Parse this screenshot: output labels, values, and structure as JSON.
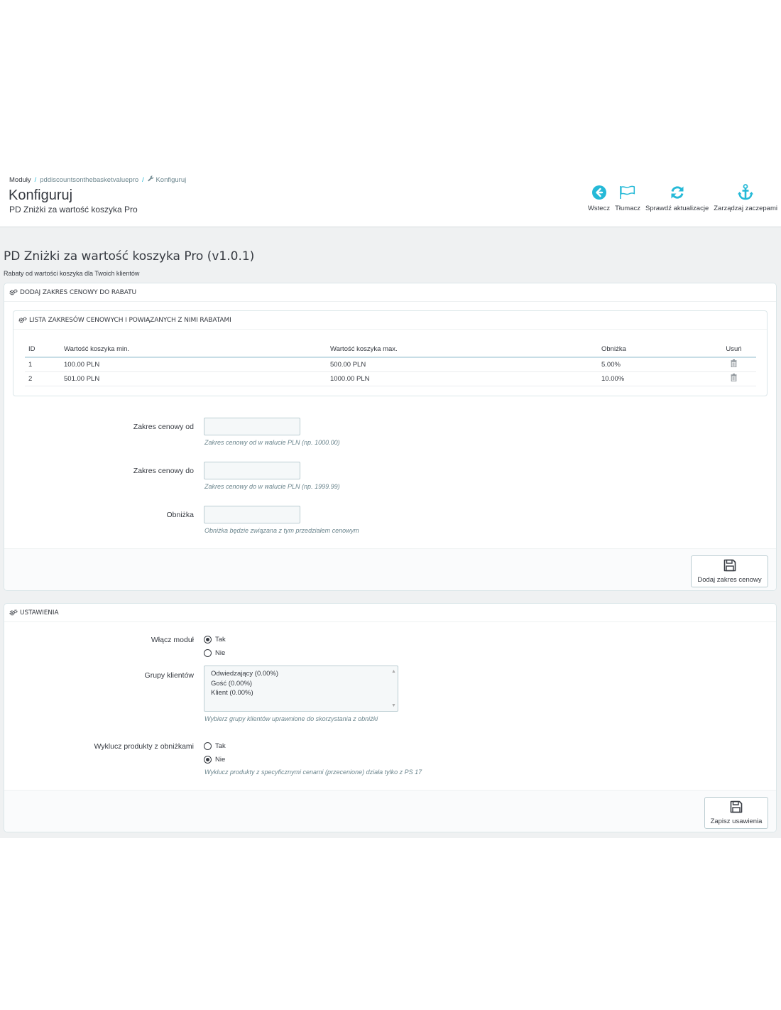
{
  "breadcrumb": {
    "items": [
      "Moduły",
      "pddiscountsonthebasketvaluepro",
      "Konfiguruj"
    ]
  },
  "header": {
    "title": "Konfiguruj",
    "subtitle": "PD Zniżki za wartość koszyka Pro"
  },
  "toolbar": {
    "back": "Wstecz",
    "translate": "Tłumacz",
    "updates": "Sprawdź aktualizacje",
    "hooks": "Zarządzaj zaczepami"
  },
  "module": {
    "title": "PD Zniżki za wartość koszyka Pro (v1.0.1)",
    "description": "Rabaty od wartości koszyka dla Twoich klientów"
  },
  "range_panel": {
    "heading": "DODAJ ZAKRES CENOWY DO RABATU",
    "list_heading": "LISTA ZAKRESÓW CENOWYCH I POWIĄZANYCH Z NIMI RABATAMI",
    "columns": [
      "ID",
      "Wartość koszyka min.",
      "Wartość koszyka max.",
      "Obniżka",
      "Usuń"
    ],
    "rows": [
      {
        "id": "1",
        "min": "100.00 PLN",
        "max": "500.00 PLN",
        "discount": "5.00%"
      },
      {
        "id": "2",
        "min": "501.00 PLN",
        "max": "1000.00 PLN",
        "discount": "10.00%"
      }
    ],
    "from_label": "Zakres cenowy od",
    "from_value": "",
    "from_help": "Zakres cenowy od w walucie PLN (np. 1000.00)",
    "to_label": "Zakres cenowy do",
    "to_value": "",
    "to_help": "Zakres cenowy do w walucie PLN (np. 1999.99)",
    "discount_label": "Obniżka",
    "discount_value": "",
    "discount_help": "Obniżka będzie związana z tym przedziałem cenowym",
    "submit": "Dodaj zakres cenowy"
  },
  "settings_panel": {
    "heading": "USTAWIENIA",
    "enable_label": "Włącz moduł",
    "enable_yes": "Tak",
    "enable_no": "Nie",
    "enable_selected": "Tak",
    "groups_label": "Grupy klientów",
    "groups": [
      "Odwiedzający (0.00%)",
      "Gość (0.00%)",
      "Klient (0.00%)"
    ],
    "groups_help": "Wybierz grupy klientów uprawnione do skorzystania z obniżki",
    "exclude_label": "Wyklucz produkty z obniżkami",
    "exclude_yes": "Tak",
    "exclude_no": "Nie",
    "exclude_selected": "Nie",
    "exclude_help": "Wyklucz produkty z specyficznymi cenami (przecenione) działa tylko z PS 17",
    "submit": "Zapisz usawienia"
  },
  "colors": {
    "accent": "#25b9d7",
    "background": "#eff1f2",
    "text": "#363a41"
  }
}
